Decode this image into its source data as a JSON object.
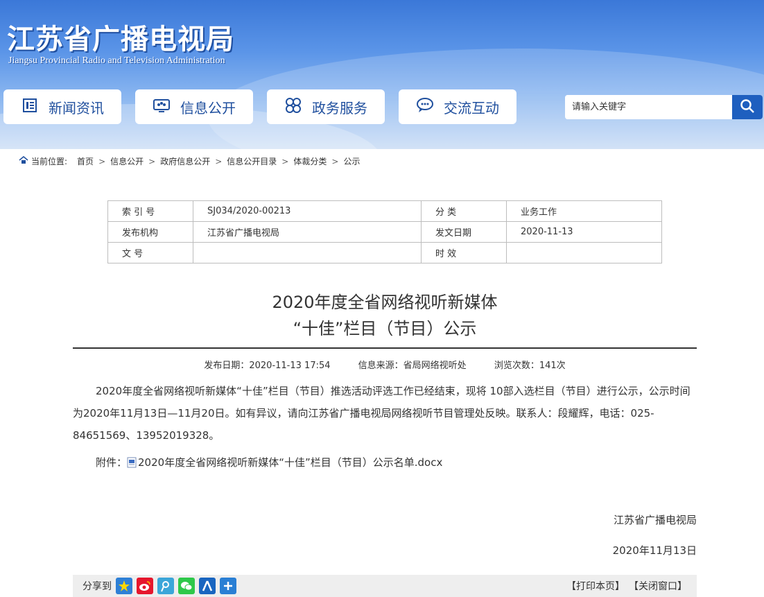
{
  "header": {
    "site_title": "江苏省广播电视局",
    "site_subtitle": "Jiangsu Provincial Radio and Television Administration",
    "nav": [
      {
        "label": "新闻资讯",
        "icon": "news-icon"
      },
      {
        "label": "信息公开",
        "icon": "info-icon"
      },
      {
        "label": "政务服务",
        "icon": "service-icon"
      },
      {
        "label": "交流互动",
        "icon": "chat-icon"
      }
    ],
    "search": {
      "placeholder": "请输入关键字",
      "icon": "search-icon"
    }
  },
  "breadcrumb": {
    "label": "当前位置:",
    "items": [
      "首页",
      "信息公开",
      "政府信息公开",
      "信息公开目录",
      "体裁分类",
      "公示"
    ]
  },
  "info_table": {
    "rows": [
      [
        "索 引 号",
        "SJ034/2020-00213",
        "分    类",
        "业务工作"
      ],
      [
        "发布机构",
        "江苏省广播电视局",
        "发文日期",
        "2020-11-13"
      ],
      [
        "文    号",
        "",
        "时    效",
        ""
      ]
    ]
  },
  "article": {
    "title_line1": "2020年度全省网络视听新媒体",
    "title_line2": "“十佳”栏目（节目）公示",
    "meta_publish": "发布日期：2020-11-13 17:54",
    "meta_source": "信息来源：省局网络视听处",
    "meta_views": "浏览次数：141次",
    "body": "2020年度全省网络视听新媒体“十佳”栏目（节目）推选活动评选工作已经结束，现将 10部入选栏目（节目）进行公示，公示时间为2020年11月13日—11月20日。如有异议，请向江苏省广播电视局网络视听节目管理处反映。联系人：段耀辉，电话：025-84651569、13952019328。",
    "attachment_label": "附件：",
    "attachment_file": "2020年度全省网络视听新媒体“十佳”栏目（节目）公示名单.docx",
    "signature": "江苏省广播电视局",
    "sign_date": "2020年11月13日"
  },
  "share_bar": {
    "label": "分享到",
    "icons": [
      "qzone-icon",
      "weibo-icon",
      "tencent-weibo-icon",
      "wechat-icon",
      "renren-icon",
      "more-icon"
    ],
    "print": "【打印本页】",
    "close": "【关闭窗口】"
  }
}
